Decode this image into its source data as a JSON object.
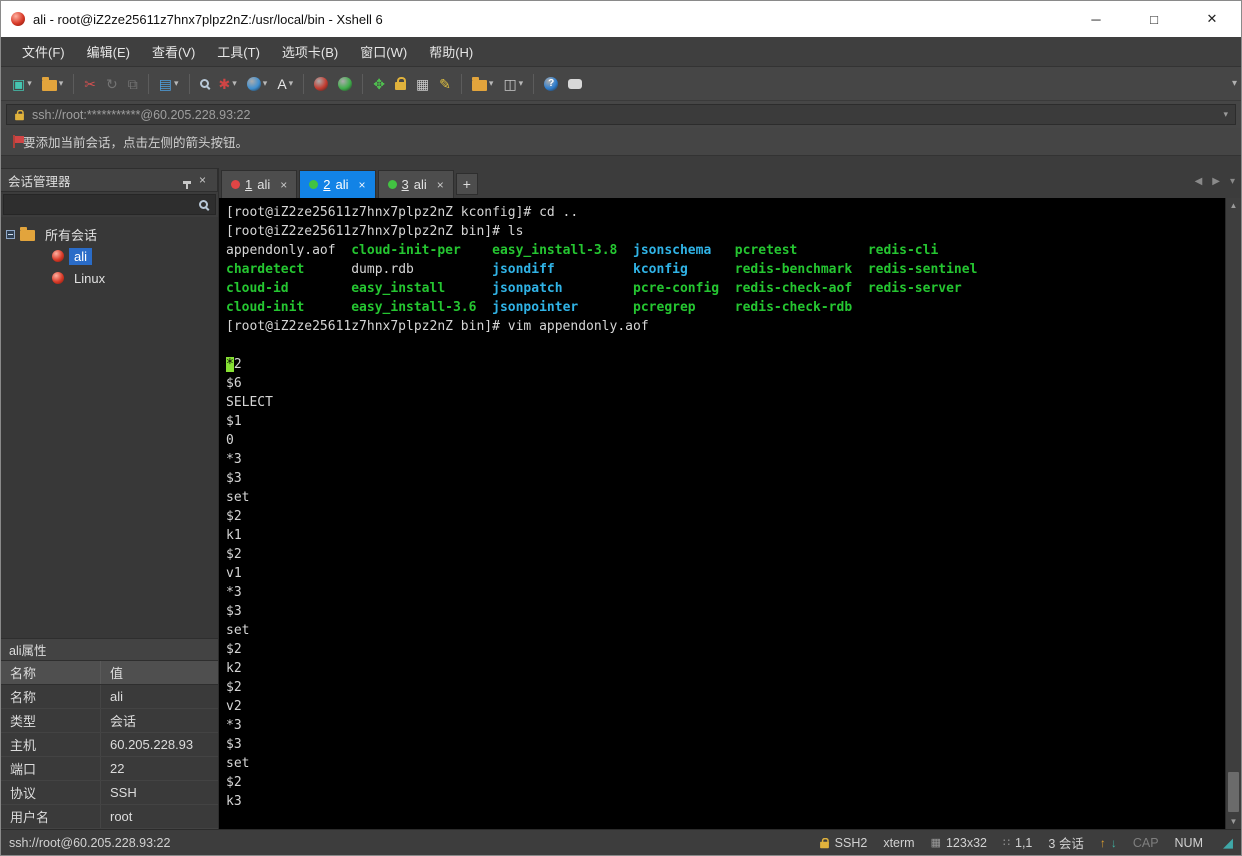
{
  "window": {
    "title": "ali - root@iZ2ze25611z7hnx7plpz2nZ:/usr/local/bin - Xshell 6",
    "controls": {
      "minimize": "─",
      "maximize": "□",
      "close": "✕"
    }
  },
  "menu": {
    "items": [
      "文件(F)",
      "编辑(E)",
      "查看(V)",
      "工具(T)",
      "选项卡(B)",
      "窗口(W)",
      "帮助(H)"
    ]
  },
  "toolbar": {
    "overflow_icon": "▾",
    "buttons": [
      {
        "name": "new-session-button",
        "shape": "glyph",
        "glyph": "▣",
        "color": "#45c4b0",
        "dropdown": true
      },
      {
        "name": "open-session-button",
        "shape": "folder",
        "dropdown": true
      },
      {
        "sep": true
      },
      {
        "name": "disconnect-button",
        "shape": "glyph",
        "glyph": "✂",
        "color": "#d05050"
      },
      {
        "name": "reconnect-button",
        "shape": "glyph",
        "glyph": "↻",
        "color": "#bababa",
        "disabled": true
      },
      {
        "name": "duplicate-session-button",
        "shape": "glyph",
        "glyph": "⧉",
        "color": "#bababa",
        "disabled": true
      },
      {
        "sep": true
      },
      {
        "name": "properties-button",
        "shape": "glyph",
        "glyph": "▤",
        "color": "#4f9fdf",
        "dropdown": true
      },
      {
        "sep": true
      },
      {
        "name": "find-button",
        "shape": "magnifier"
      },
      {
        "name": "color-scheme-button",
        "shape": "glyph",
        "glyph": "✱",
        "color": "#d04545",
        "dropdown": true
      },
      {
        "name": "encoding-button",
        "shape": "ball",
        "color": "#3f8fd0",
        "dropdown": true
      },
      {
        "name": "font-button",
        "shape": "glyph",
        "glyph": "A",
        "color": "#e8e8e8",
        "dropdown": true
      },
      {
        "sep": true
      },
      {
        "name": "xshell-button",
        "shape": "ball",
        "color": "#c43b2f"
      },
      {
        "name": "xftp-button",
        "shape": "ball",
        "color": "#3fae4a"
      },
      {
        "sep": true
      },
      {
        "name": "fullscreen-button",
        "shape": "glyph",
        "glyph": "✥",
        "color": "#4fc24f"
      },
      {
        "name": "lock-screen-button",
        "shape": "lock"
      },
      {
        "name": "soft-keyboard-button",
        "shape": "glyph",
        "glyph": "▦",
        "color": "#c8c8c8"
      },
      {
        "name": "highlight-button",
        "shape": "glyph",
        "glyph": "✎",
        "color": "#e0c040"
      },
      {
        "sep": true
      },
      {
        "name": "quick-commands-button",
        "shape": "folder",
        "dropdown": true
      },
      {
        "name": "layout-button",
        "shape": "glyph",
        "glyph": "◫",
        "color": "#c8c8c8",
        "dropdown": true
      },
      {
        "sep": true
      },
      {
        "name": "help-button",
        "shape": "ball",
        "glyph": "?",
        "color": "#2f7fd0"
      },
      {
        "name": "feedback-button",
        "shape": "bubble"
      }
    ]
  },
  "address_bar": {
    "value": "ssh://root:***********@60.205.228.93:22"
  },
  "notice": {
    "text": "要添加当前会话，点击左侧的箭头按钮。"
  },
  "sidebar": {
    "title": "会话管理器",
    "tree": {
      "root": "所有会话",
      "sessions": [
        {
          "name": "ali",
          "selected": true
        },
        {
          "name": "Linux",
          "selected": false
        }
      ]
    },
    "properties": {
      "title": "ali属性",
      "headers": [
        "名称",
        "值"
      ],
      "rows": [
        [
          "名称",
          "ali"
        ],
        [
          "类型",
          "会话"
        ],
        [
          "主机",
          "60.205.228.93"
        ],
        [
          "端口",
          "22"
        ],
        [
          "协议",
          "SSH"
        ],
        [
          "用户名",
          "root"
        ]
      ]
    }
  },
  "tabs": [
    {
      "num": "1",
      "name": "ali",
      "dot": "#e04545",
      "active": false
    },
    {
      "num": "2",
      "name": "ali",
      "dot": "#42c342",
      "active": true
    },
    {
      "num": "3",
      "name": "ali",
      "dot": "#42c342",
      "active": false
    }
  ],
  "terminal": {
    "lines": [
      {
        "segs": [
          {
            "t": "[root@iZ2ze25611z7hnx7plpz2nZ kconfig]# cd ..",
            "c": "fg"
          }
        ]
      },
      {
        "segs": [
          {
            "t": "[root@iZ2ze25611z7hnx7plpz2nZ bin]# ls",
            "c": "fg"
          }
        ]
      },
      {
        "segs": [
          {
            "t": "appendonly.aof  ",
            "c": "fg"
          },
          {
            "t": "cloud-init-per    ",
            "c": "green"
          },
          {
            "t": "easy_install-3.8  ",
            "c": "green"
          },
          {
            "t": "jsonschema   ",
            "c": "cyan"
          },
          {
            "t": "pcretest         ",
            "c": "green"
          },
          {
            "t": "redis-cli",
            "c": "green"
          }
        ]
      },
      {
        "segs": [
          {
            "t": "chardetect      ",
            "c": "green"
          },
          {
            "t": "dump.rdb          ",
            "c": "fg"
          },
          {
            "t": "jsondiff          ",
            "c": "cyan"
          },
          {
            "t": "kconfig      ",
            "c": "cyan"
          },
          {
            "t": "redis-benchmark  ",
            "c": "green"
          },
          {
            "t": "redis-sentinel",
            "c": "green"
          }
        ]
      },
      {
        "segs": [
          {
            "t": "cloud-id        ",
            "c": "green"
          },
          {
            "t": "easy_install      ",
            "c": "green"
          },
          {
            "t": "jsonpatch         ",
            "c": "cyan"
          },
          {
            "t": "pcre-config  ",
            "c": "green"
          },
          {
            "t": "redis-check-aof  ",
            "c": "green"
          },
          {
            "t": "redis-server",
            "c": "green"
          }
        ]
      },
      {
        "segs": [
          {
            "t": "cloud-init      ",
            "c": "green"
          },
          {
            "t": "easy_install-3.6  ",
            "c": "green"
          },
          {
            "t": "jsonpointer       ",
            "c": "cyan"
          },
          {
            "t": "pcregrep     ",
            "c": "green"
          },
          {
            "t": "redis-check-rdb",
            "c": "green"
          }
        ]
      },
      {
        "segs": [
          {
            "t": "[root@iZ2ze25611z7hnx7plpz2nZ bin]# vim appendonly.aof",
            "c": "fg"
          }
        ]
      },
      {
        "segs": []
      },
      {
        "segs": [
          {
            "t": "*",
            "c": "cursor"
          },
          {
            "t": "2",
            "c": "fg"
          }
        ]
      },
      {
        "segs": [
          {
            "t": "$6",
            "c": "fg"
          }
        ]
      },
      {
        "segs": [
          {
            "t": "SELECT",
            "c": "fg"
          }
        ]
      },
      {
        "segs": [
          {
            "t": "$1",
            "c": "fg"
          }
        ]
      },
      {
        "segs": [
          {
            "t": "0",
            "c": "fg"
          }
        ]
      },
      {
        "segs": [
          {
            "t": "*3",
            "c": "fg"
          }
        ]
      },
      {
        "segs": [
          {
            "t": "$3",
            "c": "fg"
          }
        ]
      },
      {
        "segs": [
          {
            "t": "set",
            "c": "fg"
          }
        ]
      },
      {
        "segs": [
          {
            "t": "$2",
            "c": "fg"
          }
        ]
      },
      {
        "segs": [
          {
            "t": "k1",
            "c": "fg"
          }
        ]
      },
      {
        "segs": [
          {
            "t": "$2",
            "c": "fg"
          }
        ]
      },
      {
        "segs": [
          {
            "t": "v1",
            "c": "fg"
          }
        ]
      },
      {
        "segs": [
          {
            "t": "*3",
            "c": "fg"
          }
        ]
      },
      {
        "segs": [
          {
            "t": "$3",
            "c": "fg"
          }
        ]
      },
      {
        "segs": [
          {
            "t": "set",
            "c": "fg"
          }
        ]
      },
      {
        "segs": [
          {
            "t": "$2",
            "c": "fg"
          }
        ]
      },
      {
        "segs": [
          {
            "t": "k2",
            "c": "fg"
          }
        ]
      },
      {
        "segs": [
          {
            "t": "$2",
            "c": "fg"
          }
        ]
      },
      {
        "segs": [
          {
            "t": "v2",
            "c": "fg"
          }
        ]
      },
      {
        "segs": [
          {
            "t": "*3",
            "c": "fg"
          }
        ]
      },
      {
        "segs": [
          {
            "t": "$3",
            "c": "fg"
          }
        ]
      },
      {
        "segs": [
          {
            "t": "set",
            "c": "fg"
          }
        ]
      },
      {
        "segs": [
          {
            "t": "$2",
            "c": "fg"
          }
        ]
      },
      {
        "segs": [
          {
            "t": "k3",
            "c": "fg"
          }
        ]
      }
    ]
  },
  "statusbar": {
    "left": "ssh://root@60.205.228.93:22",
    "protocol": "SSH2",
    "term_type": "xterm",
    "size": "123x32",
    "cursor_pos": "1,1",
    "sessions": "3 会话",
    "cap": "CAP",
    "num": "NUM"
  },
  "glyphs": {
    "dropdown": "▾",
    "tab_add": "+",
    "tab_close": "×",
    "panel_close": "×",
    "nav_left": "◀",
    "nav_right": "▶",
    "tab_menu": "▾",
    "scroll_up": "▲",
    "scroll_down": "▼",
    "size_icon": "▦",
    "pos_icon": "∷",
    "up_arrow": "↑",
    "down_arrow": "↓",
    "grip": "◢"
  },
  "colors": {
    "active_tab": "#1283e6",
    "selection": "#2a6cc8",
    "terminal_fg": "#d6d6d6",
    "terminal_green": "#25c631",
    "terminal_cyan": "#30b3e6",
    "cursor_green": "#86e034",
    "tab_dot_red": "#e04545",
    "tab_dot_green": "#42c342",
    "titlebar_bg": "#ffffff",
    "chrome_bg": "#464646",
    "terminal_bg": "#000000"
  }
}
